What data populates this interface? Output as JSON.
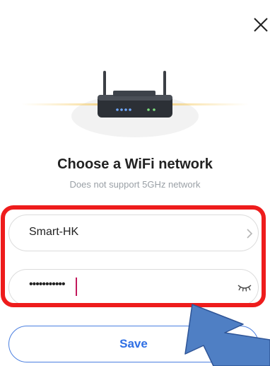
{
  "header": {
    "close_icon": "close-icon"
  },
  "illustration": {
    "icon": "router-icon"
  },
  "title": "Choose a WiFi network",
  "subtitle": "Does not support 5GHz network",
  "network_field": {
    "value": "Smart-HK",
    "icon": "chevron-right-icon"
  },
  "password_field": {
    "masked_value": "•••••••••••",
    "icon": "eye-closed-icon"
  },
  "save_button": {
    "label": "Save"
  },
  "colors": {
    "accent": "#2f6fe4",
    "highlight": "#ee1c1c",
    "caret": "#c2185b",
    "pointer_arrow": "#4f7fc4"
  }
}
